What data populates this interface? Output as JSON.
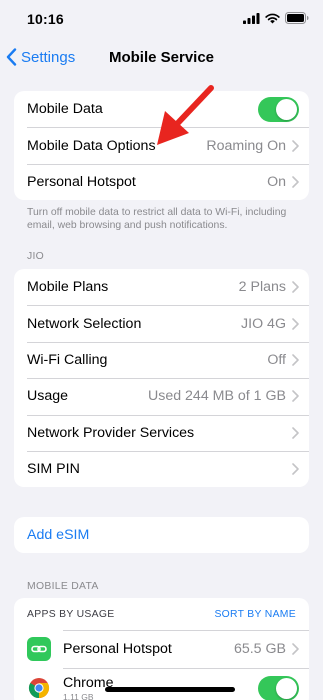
{
  "status": {
    "time": "10:16"
  },
  "nav": {
    "back_label": "Settings",
    "title": "Mobile Service"
  },
  "group1": {
    "mobile_data": {
      "label": "Mobile Data",
      "on": true
    },
    "mobile_data_options": {
      "label": "Mobile Data Options",
      "value": "Roaming On"
    },
    "personal_hotspot": {
      "label": "Personal Hotspot",
      "value": "On"
    }
  },
  "footnote": "Turn off mobile data to restrict all data to Wi-Fi, including email, web browsing and push notifications.",
  "carrier_section": {
    "header": "JIO",
    "rows": [
      {
        "label": "Mobile Plans",
        "value": "2 Plans"
      },
      {
        "label": "Network Selection",
        "value": "JIO 4G"
      },
      {
        "label": "Wi-Fi Calling",
        "value": "Off"
      },
      {
        "label": "Usage",
        "value": "Used 244 MB of 1 GB"
      },
      {
        "label": "Network Provider Services",
        "value": ""
      },
      {
        "label": "SIM PIN",
        "value": ""
      }
    ]
  },
  "esim": {
    "label": "Add eSIM"
  },
  "mobile_data_section": {
    "header": "MOBILE DATA",
    "apps_by_usage": "APPS BY USAGE",
    "sort_label": "SORT BY NAME",
    "apps": [
      {
        "name": "Personal Hotspot",
        "value": "65.5 GB",
        "icon": "hotspot-icon",
        "color": "#30c85b"
      },
      {
        "name": "Chrome",
        "sub": "1.11 GB",
        "icon": "chrome-icon",
        "toggle_on": true
      }
    ]
  },
  "colors": {
    "accent": "#1a7cf2",
    "toggle_on": "#34c759",
    "annotation_arrow": "#e8251f"
  }
}
